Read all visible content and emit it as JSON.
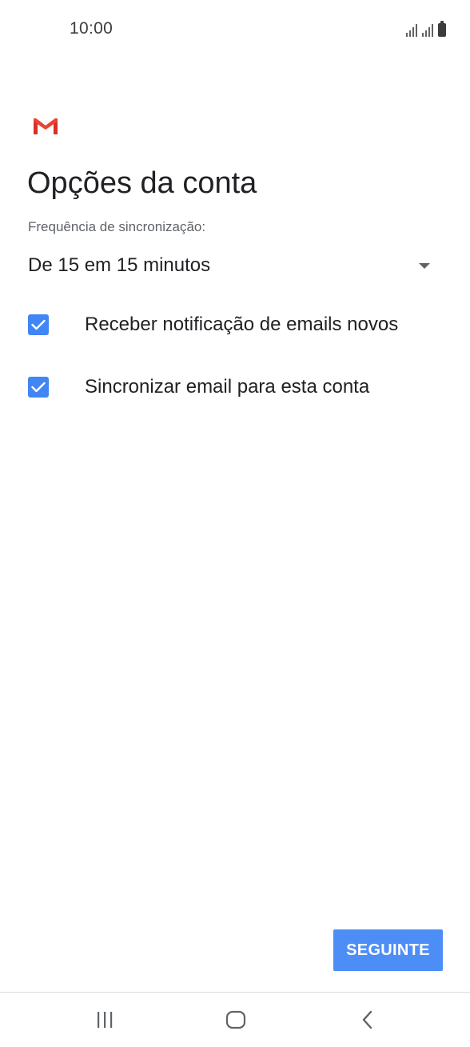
{
  "status_bar": {
    "time": "10:00",
    "icons": [
      "signal-icon",
      "signal-icon",
      "battery-icon"
    ]
  },
  "app": {
    "logo": "gmail-logo"
  },
  "page": {
    "title": "Opções da conta",
    "sync_frequency_label": "Frequência de sincronização:",
    "sync_frequency_value": "De 15 em 15 minutos"
  },
  "options": [
    {
      "label": "Receber notificação de emails novos",
      "checked": true
    },
    {
      "label": "Sincronizar email para esta conta",
      "checked": true
    }
  ],
  "actions": {
    "next_label": "SEGUINTE"
  },
  "nav_bar": {
    "icons": [
      "recent-apps-icon",
      "home-icon",
      "back-icon"
    ]
  },
  "colors": {
    "accent": "#4285f4",
    "button": "#4d8df6",
    "gmail_red": "#d93025"
  }
}
